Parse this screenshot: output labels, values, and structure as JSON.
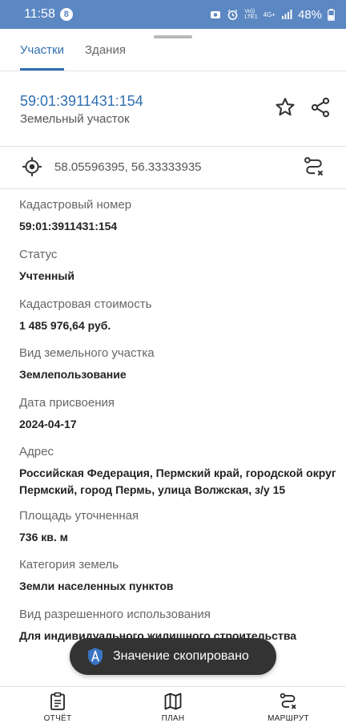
{
  "status_bar": {
    "time": "11:58",
    "notification_count": "8",
    "network_top": "Vo))",
    "network_bottom": "LTE1",
    "network_type": "4G+",
    "battery": "48%"
  },
  "tabs": [
    {
      "label": "Участки",
      "active": true
    },
    {
      "label": "Здания",
      "active": false
    }
  ],
  "header": {
    "cadastral_number": "59:01:3911431:154",
    "subtitle": "Земельный участок"
  },
  "coordinates": "58.05596395, 56.33333935",
  "fields": [
    {
      "label": "Кадастровый номер",
      "value": "59:01:3911431:154"
    },
    {
      "label": "Статус",
      "value": "Учтенный"
    },
    {
      "label": "Кадастровая стоимость",
      "value": "1 485 976,64 руб."
    },
    {
      "label": "Вид земельного участка",
      "value": "Землепользование"
    },
    {
      "label": "Дата присвоения",
      "value": "2024-04-17"
    },
    {
      "label": "Адрес",
      "value_line1": "Российская Федерация, Пермский край, городской округ",
      "value_line2": "Пермский, город Пермь, улица Волжская, з/у 15"
    },
    {
      "label": "Площадь уточненная",
      "value": "736 кв. м"
    },
    {
      "label": "Категория земель",
      "value": "Земли населенных пунктов"
    },
    {
      "label": "Вид разрешенного использования",
      "value": "Для индивидуального жилищного строительства"
    }
  ],
  "toast": "Значение скопировано",
  "bottom_nav": [
    {
      "label": "ОТЧЁТ"
    },
    {
      "label": "ПЛАН"
    },
    {
      "label": "МАРШРУТ"
    }
  ],
  "colors": {
    "status_bar": "#5b87c2",
    "accent": "#2f6fb0",
    "toast_bg": "#333333"
  }
}
